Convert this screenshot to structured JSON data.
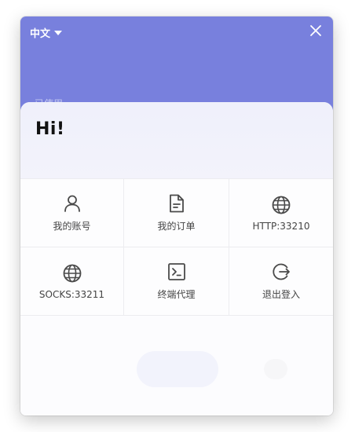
{
  "header": {
    "language": "中文",
    "faint_text": "已使用"
  },
  "greeting": "Hi!",
  "menu": [
    {
      "label": "我的账号",
      "icon": "user-icon"
    },
    {
      "label": "我的订单",
      "icon": "document-icon"
    },
    {
      "label": "HTTP:33210",
      "icon": "globe-icon"
    },
    {
      "label": "SOCKS:33211",
      "icon": "globe-icon"
    },
    {
      "label": "终端代理",
      "icon": "terminal-icon"
    },
    {
      "label": "退出登入",
      "icon": "logout-icon"
    }
  ],
  "colors": {
    "header_bg": "#7880dd",
    "icon": "#4a4a4a"
  }
}
